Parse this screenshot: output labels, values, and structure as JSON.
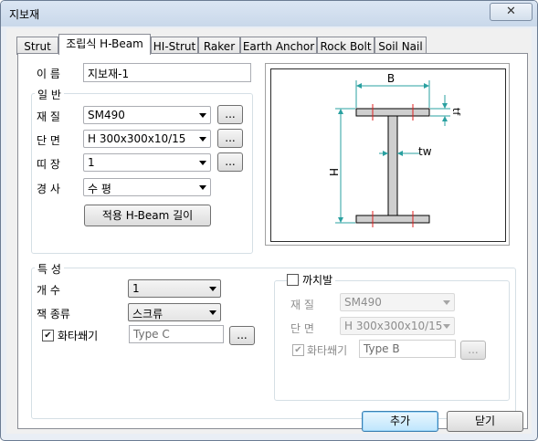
{
  "window": {
    "title": "지보재",
    "close_icon": "close-icon"
  },
  "tabs": [
    {
      "label": "Strut",
      "active": false
    },
    {
      "label": "조립식 H-Beam",
      "active": true
    },
    {
      "label": "HI-Strut",
      "active": false
    },
    {
      "label": "Raker",
      "active": false
    },
    {
      "label": "Earth Anchor",
      "active": false
    },
    {
      "label": "Rock Bolt",
      "active": false
    },
    {
      "label": "Soil Nail",
      "active": false
    }
  ],
  "name": {
    "label": "이 름",
    "value": "지보재-1"
  },
  "general": {
    "title": "일 반",
    "material": {
      "label": "재 질",
      "value": "SM490",
      "browse": "..."
    },
    "section": {
      "label": "단 면",
      "value": "H 300x300x10/15",
      "browse": "..."
    },
    "wale": {
      "label": "띠 장",
      "value": "1",
      "browse": "..."
    },
    "slope": {
      "label": "경 사",
      "value": "수 평"
    },
    "apply_button": "적용 H-Beam 길이"
  },
  "diagram": {
    "dim_b": "B",
    "dim_h": "H",
    "dim_tw": "tw",
    "dim_tf": "tf"
  },
  "properties": {
    "title": "특 성",
    "count": {
      "label": "개 수",
      "value": "1"
    },
    "jack_type": {
      "label": "잭 종류",
      "value": "스크류"
    },
    "wedge": {
      "label": "화타쐐기",
      "checked": true,
      "value": "Type C",
      "browse": "..."
    }
  },
  "bracket": {
    "label": "까치발",
    "checked": false,
    "material": {
      "label": "재 질",
      "value": "SM490"
    },
    "section": {
      "label": "단 면",
      "value": "H 300x300x10/15"
    },
    "wedge": {
      "label": "화타쐐기",
      "checked": true,
      "value": "Type B",
      "browse": "..."
    }
  },
  "footer": {
    "add": "추가",
    "close": "닫기"
  }
}
